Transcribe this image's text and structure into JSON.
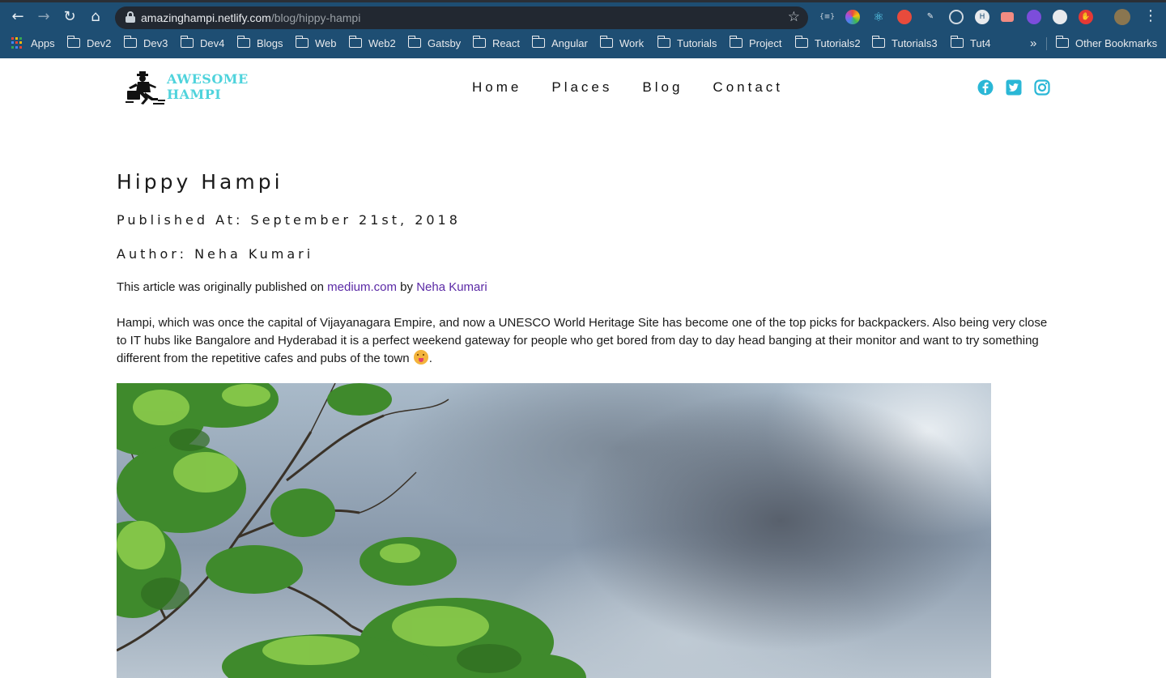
{
  "browser": {
    "url_host": "amazinghampi.netlify.com",
    "url_path": "/blog/hippy-hampi",
    "bookmarks": [
      "Apps",
      "Dev2",
      "Dev3",
      "Dev4",
      "Blogs",
      "Web",
      "Web2",
      "Gatsby",
      "React",
      "Angular",
      "Work",
      "Tutorials",
      "Project",
      "Tutorials2",
      "Tutorials3",
      "Tut4"
    ],
    "overflow": "»",
    "other_bookmarks": "Other Bookmarks"
  },
  "site": {
    "logo_line1": "AWESOME",
    "logo_line2": "HAMPI",
    "nav": [
      "Home",
      "Places",
      "Blog",
      "Contact"
    ],
    "social_icons": [
      "facebook-icon",
      "twitter-icon",
      "instagram-icon"
    ],
    "accent": "#2ab7d6"
  },
  "article": {
    "title": "Hippy Hampi",
    "published": "Published At: September 21st, 2018",
    "author": "Author: Neha Kumari",
    "intro_prefix": "This article was originally published on",
    "intro_link1": "medium.com",
    "intro_mid": "by",
    "intro_link2": "Neha Kumari",
    "body": "Hampi, which was once the capital of Vijayanagara Empire, and now a UNESCO World Heritage Site has become one of the top picks for backpackers. Also being very close to IT hubs like Bangalore and Hyderabad it is a perfect weekend gateway for people who get bored from day to day head banging at their monitor and want to try something different from the repetitive cafes and pubs of the town",
    "body_end": "."
  }
}
